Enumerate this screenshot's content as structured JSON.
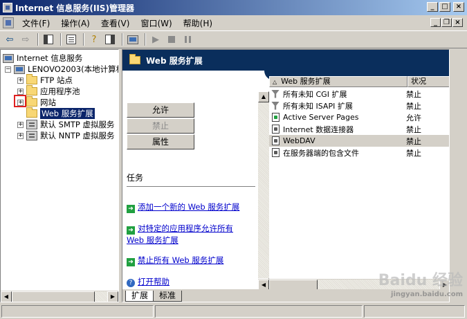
{
  "window": {
    "title": "Internet 信息服务(IIS)管理器"
  },
  "menu": [
    "文件(F)",
    "操作(A)",
    "查看(V)",
    "窗口(W)",
    "帮助(H)"
  ],
  "tree": {
    "root": "Internet 信息服务",
    "computer": "LENOVO2003(本地计算机",
    "items": [
      {
        "label": "FTP 站点",
        "icon": "folder-icon"
      },
      {
        "label": "应用程序池",
        "icon": "folder-icon"
      },
      {
        "label": "网站",
        "icon": "folder-icon"
      },
      {
        "label": "Web 服务扩展",
        "icon": "folder-icon",
        "selected": true
      },
      {
        "label": "默认 SMTP 虚拟服务",
        "icon": "mail-server-icon"
      },
      {
        "label": "默认 NNTP 虚拟服务",
        "icon": "news-server-icon"
      }
    ]
  },
  "panel": {
    "title": "Web 服务扩展",
    "buttons": {
      "allow": "允许",
      "prohibit": "禁止",
      "properties": "属性"
    },
    "tasks_title": "任务",
    "tasks": [
      "添加一个新的 Web 服务扩展",
      "对特定的应用程序允许所有 Web 服务扩展",
      "禁止所有 Web 服务扩展"
    ],
    "help": "打开帮助"
  },
  "list": {
    "columns": [
      "Web 服务扩展",
      "状况"
    ],
    "rows": [
      {
        "name": "所有未知 CGI 扩展",
        "status": "禁止",
        "icon": "filter-icon"
      },
      {
        "name": "所有未知 ISAPI 扩展",
        "status": "禁止",
        "icon": "filter-icon"
      },
      {
        "name": "Active Server Pages",
        "status": "允许",
        "icon": "allowed-page-icon"
      },
      {
        "name": "Internet 数据连接器",
        "status": "禁止",
        "icon": "page-icon"
      },
      {
        "name": "WebDAV",
        "status": "禁止",
        "icon": "page-icon",
        "selected": true
      },
      {
        "name": "在服务器端的包含文件",
        "status": "禁止",
        "icon": "page-icon"
      }
    ]
  },
  "tabs": [
    "扩展",
    "标准"
  ],
  "watermark": {
    "main": "Baidu 经验",
    "sub": "jingyan.baidu.com"
  }
}
